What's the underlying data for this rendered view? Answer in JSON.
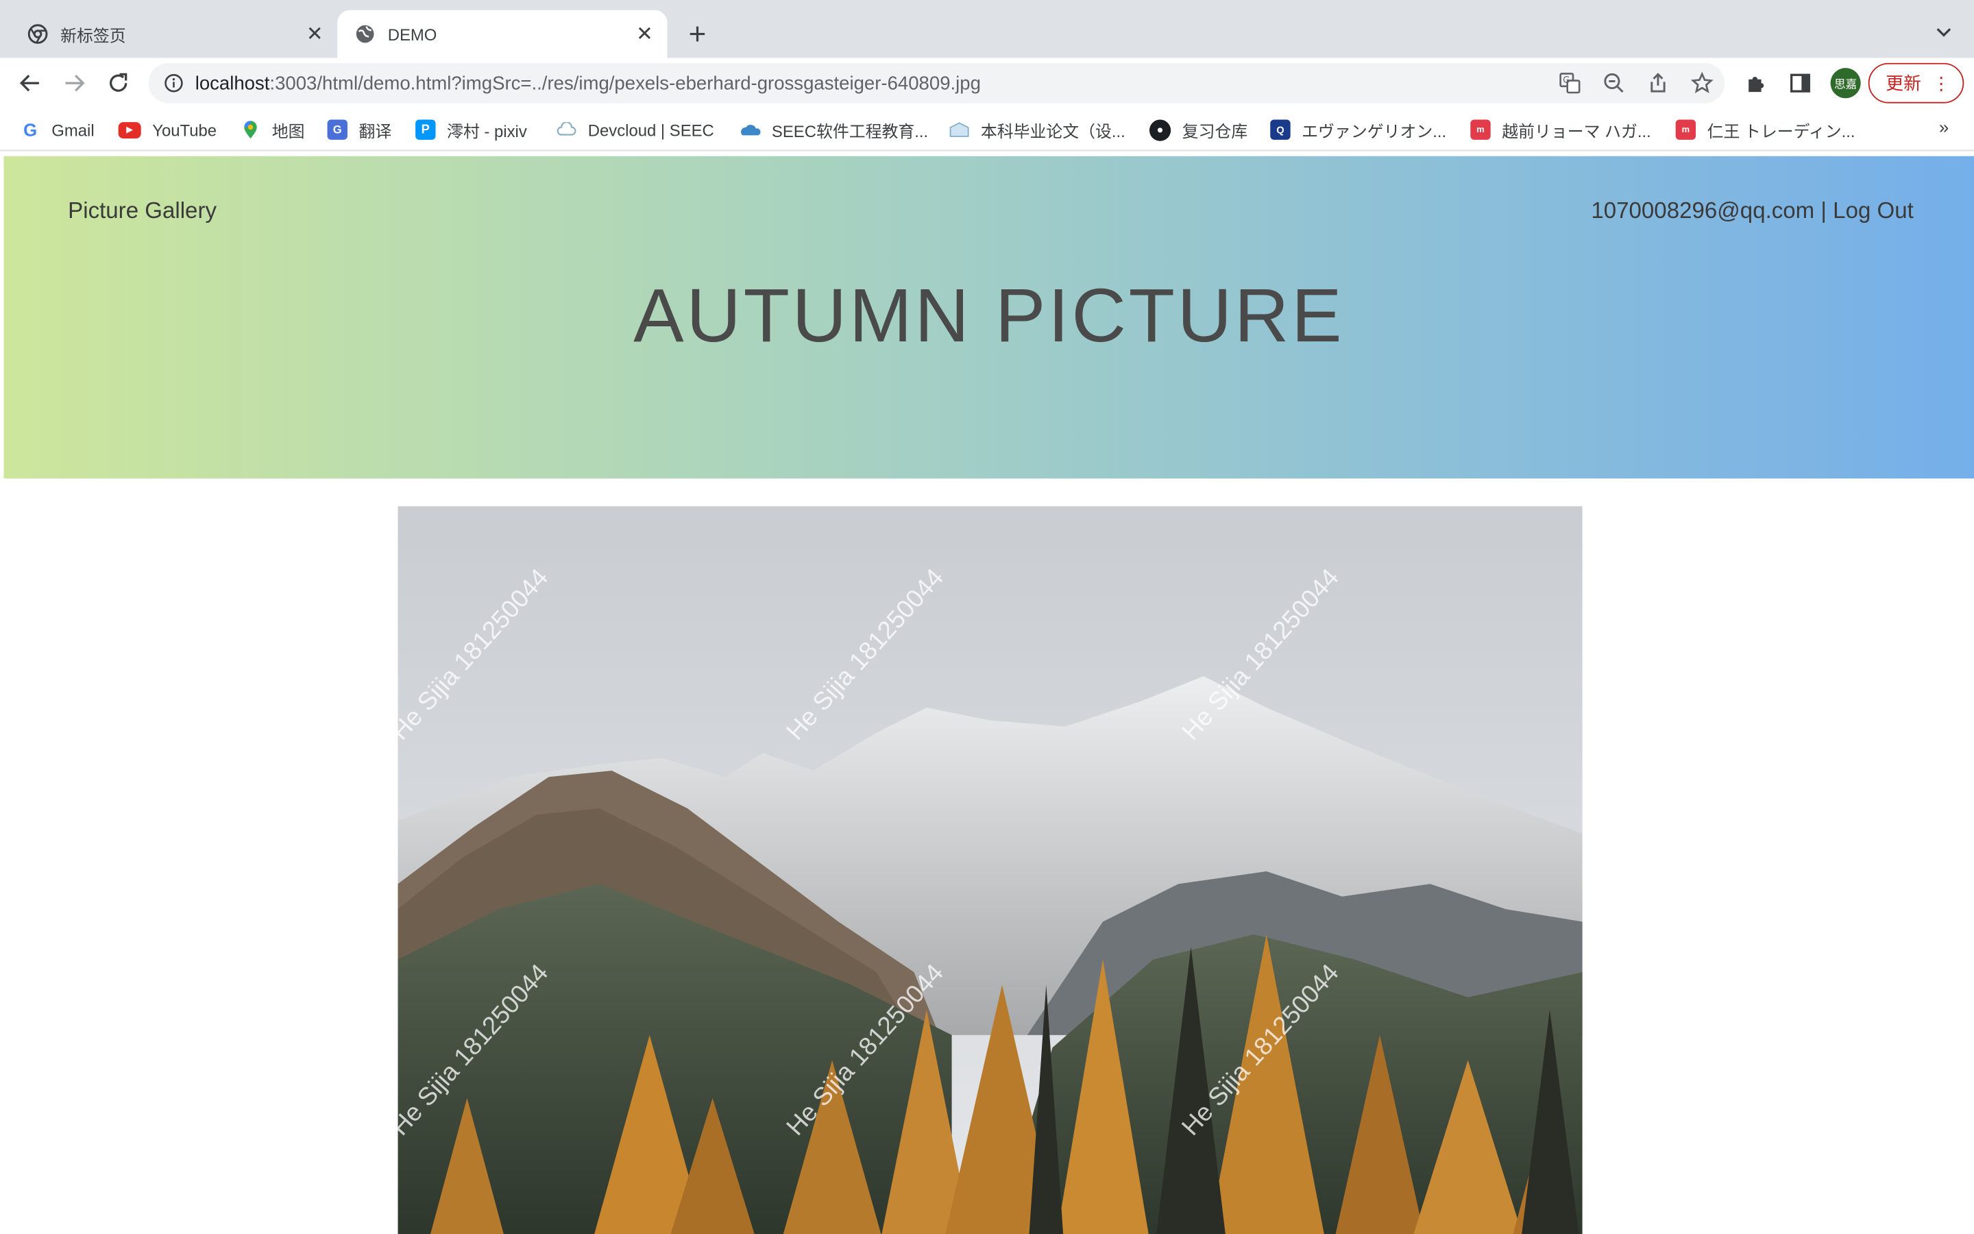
{
  "browser": {
    "tabs": [
      {
        "title": "新标签页",
        "active": false
      },
      {
        "title": "DEMO",
        "active": true
      }
    ],
    "url": {
      "host": "localhost",
      "rest": ":3003/html/demo.html?imgSrc=../res/img/pexels-eberhard-grossgasteiger-640809.jpg"
    },
    "profile_initials": "思嘉",
    "update_label": "更新",
    "bookmarks": [
      {
        "label": "Gmail",
        "icon": "gmail-icon"
      },
      {
        "label": "YouTube",
        "icon": "youtube-icon"
      },
      {
        "label": "地图",
        "icon": "maps-icon"
      },
      {
        "label": "翻译",
        "icon": "translate-icon"
      },
      {
        "label": "澪村 - pixiv",
        "icon": "pixiv-icon"
      },
      {
        "label": "Devcloud | SEEC",
        "icon": "cloud-icon"
      },
      {
        "label": "SEEC软件工程教育...",
        "icon": "seec-icon"
      },
      {
        "label": "本科毕业论文（设...",
        "icon": "thesis-icon"
      },
      {
        "label": "复习仓库",
        "icon": "github-icon"
      },
      {
        "label": "エヴァンゲリオン...",
        "icon": "eva-icon"
      },
      {
        "label": "越前リョーマ ハガ...",
        "icon": "shop-icon"
      },
      {
        "label": "仁王 トレーディン...",
        "icon": "shop-icon"
      }
    ],
    "bookmarks_more": "»"
  },
  "page": {
    "brand": "Picture Gallery",
    "account": "1070008296@qq.com | Log Out",
    "title": "AUTUMN PICTURE",
    "watermark": "He Sijia 181250044",
    "colors": {
      "gradient_start": "#cde69c",
      "gradient_end": "#75afe9",
      "update_red": "#c5221f"
    }
  }
}
